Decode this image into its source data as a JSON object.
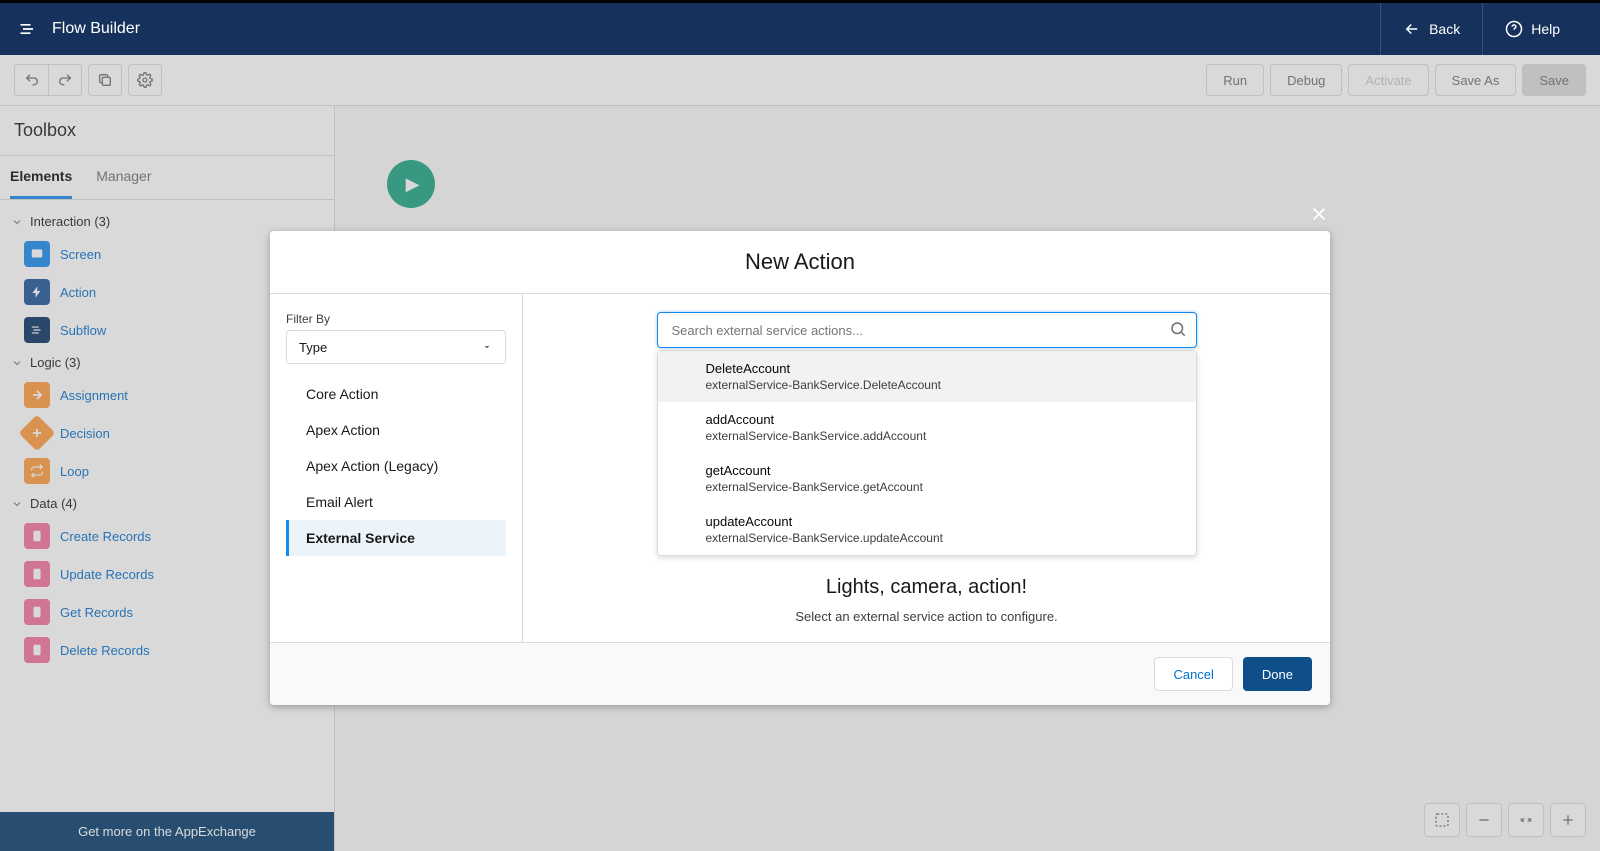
{
  "header": {
    "app_title": "Flow Builder",
    "back_label": "Back",
    "help_label": "Help"
  },
  "actionbar": {
    "run": "Run",
    "debug": "Debug",
    "activate": "Activate",
    "save_as": "Save As",
    "save": "Save"
  },
  "toolbox": {
    "title": "Toolbox",
    "tabs": {
      "elements": "Elements",
      "manager": "Manager"
    },
    "groups": [
      {
        "label": "Interaction (3)",
        "items": [
          {
            "icon": "screen",
            "label": "Screen"
          },
          {
            "icon": "action",
            "label": "Action"
          },
          {
            "icon": "subflow",
            "label": "Subflow"
          }
        ]
      },
      {
        "label": "Logic (3)",
        "items": [
          {
            "icon": "assign",
            "label": "Assignment"
          },
          {
            "icon": "decision",
            "label": "Decision"
          },
          {
            "icon": "loop",
            "label": "Loop"
          }
        ]
      },
      {
        "label": "Data (4)",
        "items": [
          {
            "icon": "data",
            "label": "Create Records"
          },
          {
            "icon": "data",
            "label": "Update Records"
          },
          {
            "icon": "data",
            "label": "Get Records"
          },
          {
            "icon": "data",
            "label": "Delete Records"
          }
        ]
      }
    ],
    "footer": "Get more on the AppExchange"
  },
  "modal": {
    "title": "New Action",
    "filter_by": "Filter By",
    "filter_value": "Type",
    "categories": [
      "Core Action",
      "Apex Action",
      "Apex Action (Legacy)",
      "Email Alert",
      "External Service"
    ],
    "selected_category_index": 4,
    "search_placeholder": "Search external service actions...",
    "results": [
      {
        "title": "DeleteAccount",
        "sub": "externalService-BankService.DeleteAccount"
      },
      {
        "title": "addAccount",
        "sub": "externalService-BankService.addAccount"
      },
      {
        "title": "getAccount",
        "sub": "externalService-BankService.getAccount"
      },
      {
        "title": "updateAccount",
        "sub": "externalService-BankService.updateAccount"
      }
    ],
    "camera_title": "Lights, camera, action!",
    "camera_sub": "Select an external service action to configure.",
    "cancel": "Cancel",
    "done": "Done"
  }
}
